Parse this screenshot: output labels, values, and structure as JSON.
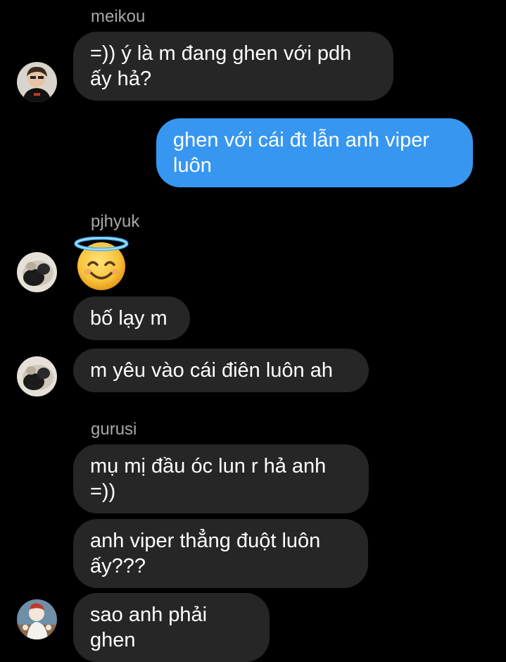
{
  "thread": {
    "messages": [
      {
        "sender": "meikou",
        "text": "=)) ý là m đang ghen với pdh\nấy hả?"
      },
      {
        "sender": "me",
        "text": "ghen với cái đt lẫn anh viper\nluôn"
      },
      {
        "sender": "pjhyuk",
        "emoji": "smiling-face-with-halo"
      },
      {
        "sender": "pjhyuk",
        "text": "bố lạy m"
      },
      {
        "sender": "pjhyuk",
        "text": "m yêu vào cái điên luôn ah"
      },
      {
        "sender": "gurusi",
        "text": "mụ mị đầu óc lun r hả anh\n=))"
      },
      {
        "sender": "gurusi",
        "text": "anh viper thẳng đuột luôn\nấy???"
      },
      {
        "sender": "gurusi",
        "text": "sao anh phải ghen"
      }
    ],
    "senders": {
      "meikou": "meikou",
      "pjhyuk": "pjhyuk",
      "gurusi": "gurusi"
    }
  },
  "colors": {
    "background": "#000000",
    "incoming_bubble": "#262626",
    "outgoing_bubble": "#3797f0",
    "sender_name": "#a8a8a8",
    "text": "#ffffff"
  }
}
